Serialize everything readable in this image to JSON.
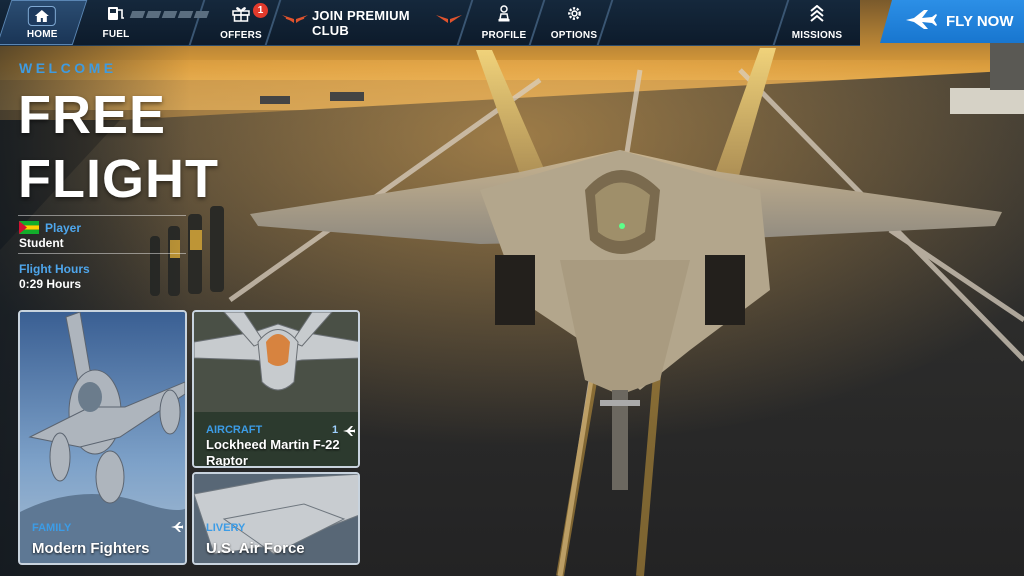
{
  "topbar": {
    "home_label": "HOME",
    "fuel_label": "FUEL",
    "offers_label": "OFFERS",
    "offers_badge": "1",
    "premium_label": "JOIN PREMIUM CLUB",
    "profile_label": "PROFILE",
    "options_label": "OPTIONS",
    "missions_label": "MISSIONS",
    "icons": {
      "home": "home-icon",
      "fuel": "fuel-pump-icon",
      "offers": "gift-icon",
      "premium": "wings-icon",
      "profile": "chess-pawn-icon",
      "options": "gear-icon",
      "missions": "rank-chevrons-icon"
    }
  },
  "fly_now": {
    "label": "FLY NOW",
    "icon": "airplane-icon",
    "color": "#1e82db"
  },
  "left_panel": {
    "welcome": "WELCOME",
    "title_line1": "FREE",
    "title_line2": "FLIGHT",
    "player_label": "Player",
    "player_value": "Student",
    "flight_hours_label": "Flight Hours",
    "flight_hours_value": "0:29 Hours"
  },
  "cards": {
    "family": {
      "category": "FAMILY",
      "name": "Modern Fighters"
    },
    "aircraft": {
      "category": "AIRCRAFT",
      "count": "1",
      "name_line1": "Lockheed Martin F-22",
      "name_line2": "Raptor"
    },
    "livery": {
      "category": "LIVERY",
      "name": "U.S. Air Force"
    }
  },
  "colors": {
    "accent_blue": "#3f9be0",
    "topbar_bg": "#0d1b2b",
    "badge_red": "#e23a2c",
    "premium_wings": "#e0532d"
  }
}
